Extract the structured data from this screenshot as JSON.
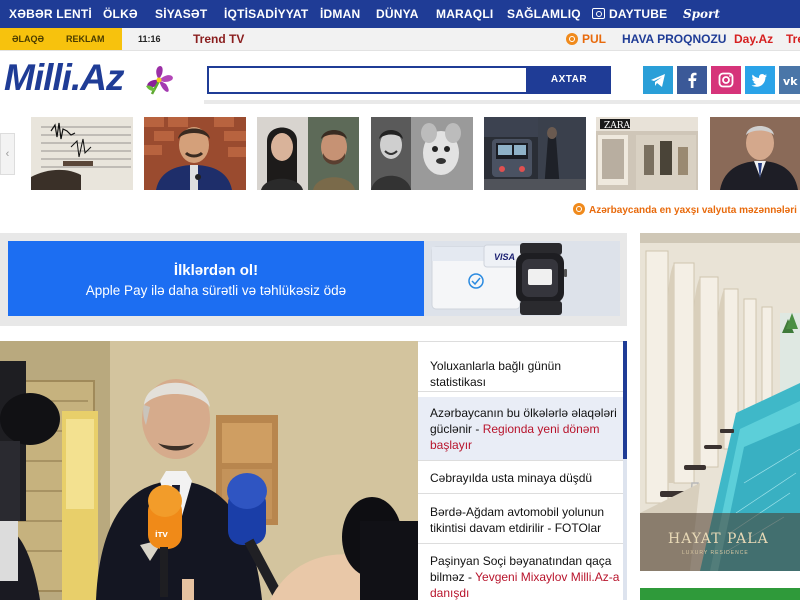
{
  "top_nav": {
    "items": [
      "XƏBƏR LENTİ",
      "ÖLKƏ",
      "SİYASƏT",
      "İQTİSADİYYAT",
      "İDMAN",
      "DÜNYA",
      "MARAQLI",
      "SAĞLAMLIQ",
      "DAYTUBE",
      "Sport"
    ],
    "background": "#1f3c96"
  },
  "util_bar": {
    "elaqe": "ƏLAQƏ",
    "reklam": "REKLAM",
    "time": "11:16",
    "trend_tv": "Trend TV",
    "pul": "PUL",
    "hava": "HAVA PROQNOZU",
    "day_az": "Day.Az",
    "trend": "Tre"
  },
  "header": {
    "logo": "Milli.Az",
    "search_placeholder": "",
    "search_button": "AXTAR",
    "social_icons": [
      "telegram-icon",
      "facebook-icon",
      "instagram-icon",
      "twitter-icon",
      "vk-icon"
    ]
  },
  "thumbnails": {
    "prev_arrow": "‹"
  },
  "marquee": "Azərbaycanda en yaxşı valyuta məzənnələri",
  "ad_banner": {
    "headline": "İlklərdən ol!",
    "subline": "Apple Pay ilə daha sürətli və təhlükəsiz ödə",
    "card_brand": "VISA"
  },
  "side_ad": {
    "brand": "HAYAT PALA",
    "sub": "LUXURY RESIDENCE"
  },
  "news_list": [
    {
      "text": "Yoluxanlarla bağlı günün statistikası",
      "extra": ""
    },
    {
      "text": "Azərbaycanın bu ölkələrlə əlaqələri güclənir - ",
      "extra": "Regionda yeni dönəm başlayır"
    },
    {
      "text": "Cəbrayılda usta minaya düşdü",
      "extra": ""
    },
    {
      "text": "Bərdə-Ağdam avtomobil yolunun tikintisi davam etdirilir - FOTOlar",
      "extra": ""
    },
    {
      "text": "Paşinyan Soçi bəyanatından qaça bilməz - ",
      "extra": "Yevgeni Mixaylov Milli.Az-a danışdı"
    }
  ]
}
